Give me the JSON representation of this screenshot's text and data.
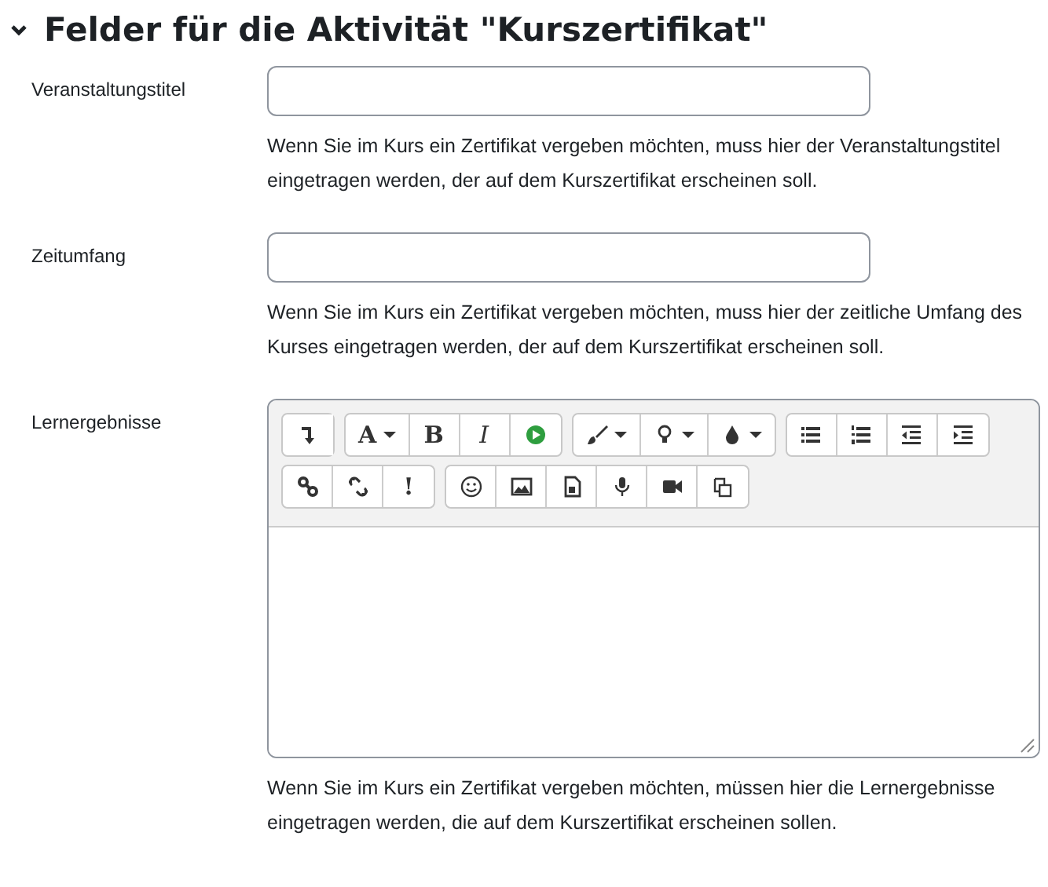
{
  "section": {
    "title": "Felder für die Aktivität \"Kurszertifikat\"",
    "expanded": true
  },
  "fields": [
    {
      "kind": "text",
      "label": "Veranstaltungstitel",
      "help": "Wenn Sie im Kurs ein Zertifikat vergeben möchten, muss hier der Veranstaltungstitel eingetragen werden, der auf dem Kurszertifikat erscheinen soll."
    },
    {
      "kind": "text",
      "label": "Zeitumfang",
      "help": "Wenn Sie im Kurs ein Zertifikat vergeben möchten, muss hier der zeitliche Umfang des Kurses eingetragen werden, der auf dem Kurszertifikat erscheinen soll."
    },
    {
      "kind": "editor",
      "label": "Lernergebnisse",
      "help": "Wenn Sie im Kurs ein Zertifikat vergeben möchten, müssen hier die Lernergebnisse eingetragen werden, die auf dem Kurszertifikat erscheinen sollen.",
      "toolbar": [
        [
          [
            {
              "dropdown": false
            }
          ],
          [
            {
              "label": "A",
              "dropdown": true
            },
            {
              "label": "B",
              "dropdown": false
            },
            {
              "label": "I",
              "dropdown": false
            },
            {
              "dropdown": false
            }
          ],
          [
            {
              "dropdown": true
            },
            {
              "dropdown": true
            },
            {
              "dropdown": true
            }
          ],
          [
            {
              "dropdown": false
            },
            {
              "dropdown": false
            },
            {
              "dropdown": false
            },
            {
              "dropdown": false
            }
          ]
        ],
        [
          [
            {
              "dropdown": false
            },
            {
              "dropdown": false
            },
            {
              "label": "!",
              "dropdown": false
            }
          ],
          [
            {
              "dropdown": false
            },
            {
              "dropdown": false
            },
            {
              "dropdown": false
            },
            {
              "dropdown": false
            },
            {
              "dropdown": false
            },
            {
              "dropdown": false
            }
          ]
        ]
      ]
    }
  ]
}
